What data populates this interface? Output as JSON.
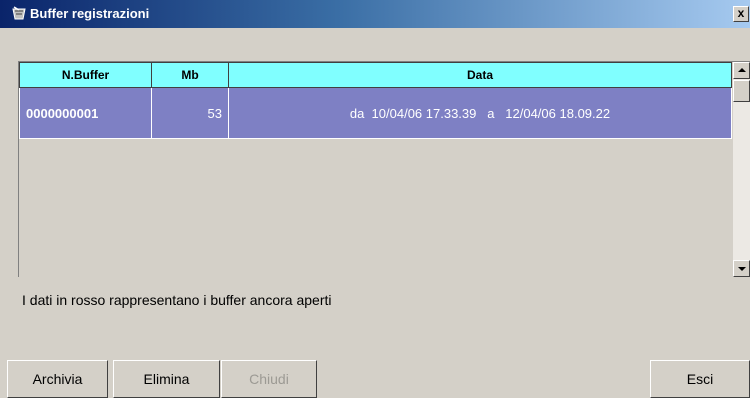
{
  "window": {
    "title": "Buffer registrazioni",
    "close_label": "x"
  },
  "grid": {
    "columns": [
      "N.Buffer",
      "Mb",
      "Data"
    ],
    "rows": [
      {
        "buffer": "0000000001",
        "mb": "53",
        "data": "da  10/04/06 17.33.39   a   12/04/06 18.09.22"
      }
    ]
  },
  "note": "I dati in rosso rappresentano i buffer ancora aperti",
  "buttons": {
    "archivia": "Archivia",
    "elimina": "Elimina",
    "chiudi": "Chiudi",
    "esci": "Esci"
  },
  "colors": {
    "header_bg": "#80ffff",
    "selected_row_bg": "#7e80c4",
    "window_bg": "#d4d0c8"
  }
}
